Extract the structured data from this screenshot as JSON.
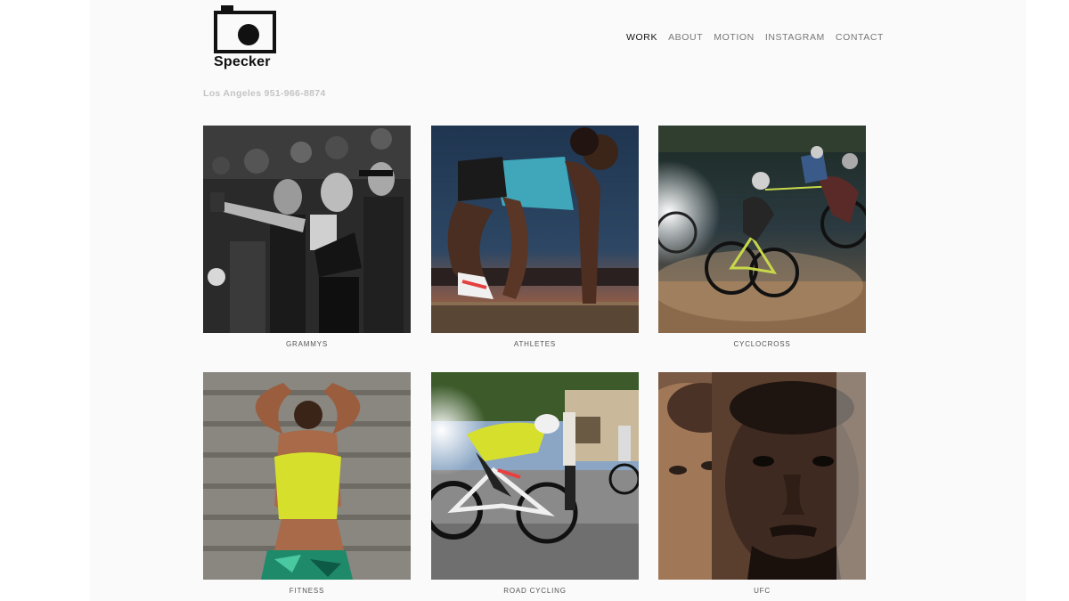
{
  "brand": {
    "name": "Specker"
  },
  "nav": {
    "items": [
      {
        "label": "WORK",
        "active": true
      },
      {
        "label": "ABOUT",
        "active": false
      },
      {
        "label": "MOTION",
        "active": false
      },
      {
        "label": "INSTAGRAM",
        "active": false
      },
      {
        "label": "CONTACT",
        "active": false
      }
    ]
  },
  "tagline": "Los Angeles 951-966-8874",
  "gallery": [
    {
      "caption": "GRAMMYS"
    },
    {
      "caption": "ATHLETES"
    },
    {
      "caption": "CYCLOCROSS"
    },
    {
      "caption": "FITNESS"
    },
    {
      "caption": "ROAD CYCLING"
    },
    {
      "caption": "UFC"
    }
  ]
}
